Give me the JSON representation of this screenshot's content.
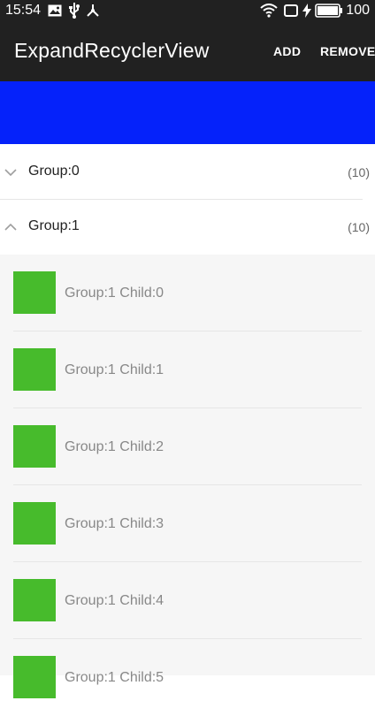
{
  "status": {
    "time": "15:54",
    "battery": "100"
  },
  "toolbar": {
    "title": "ExpandRecyclerView",
    "add_label": "ADD",
    "remove_label": "REMOVE"
  },
  "groups": [
    {
      "label": "Group:0",
      "count": "(10)",
      "expanded": false
    },
    {
      "label": "Group:1",
      "count": "(10)",
      "expanded": true
    }
  ],
  "children": [
    {
      "label": "Group:1 Child:0"
    },
    {
      "label": "Group:1 Child:1"
    },
    {
      "label": "Group:1 Child:2"
    },
    {
      "label": "Group:1 Child:3"
    },
    {
      "label": "Group:1 Child:4"
    },
    {
      "label": "Group:1 Child:5"
    }
  ],
  "colors": {
    "toolbar": "#212121",
    "header": "#0522fa",
    "thumb": "#47bb2c"
  }
}
